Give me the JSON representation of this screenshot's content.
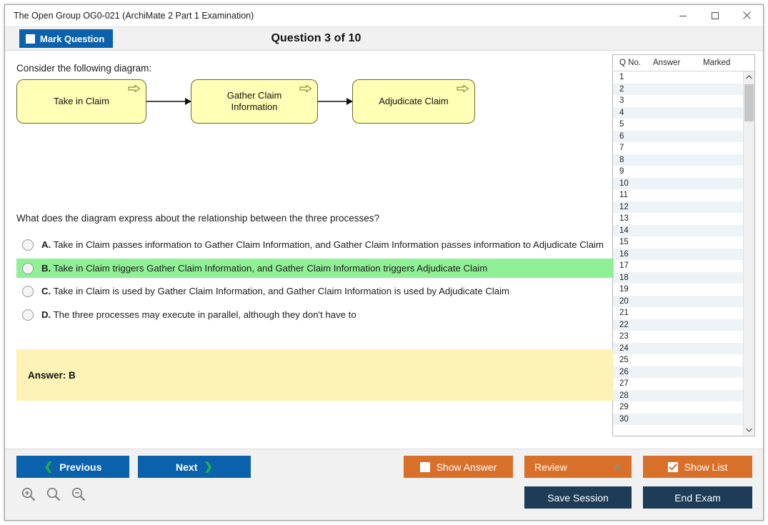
{
  "window": {
    "title": "The Open Group OG0-021 (ArchiMate 2 Part 1 Examination)",
    "minimize_label": "–",
    "maximize_label": "□",
    "close_label": "×"
  },
  "header": {
    "mark_question_label": "Mark Question",
    "question_counter": "Question 3 of 10"
  },
  "content": {
    "intro": "Consider the following diagram:",
    "question": "What does the diagram express about the relationship between the three processes?",
    "diagram": {
      "type": "archimate-business-process-flow",
      "nodes": [
        {
          "label": "Take in Claim"
        },
        {
          "label": "Gather Claim\nInformation"
        },
        {
          "label": "Adjudicate Claim"
        }
      ],
      "connector_type": "triggering"
    },
    "options": [
      {
        "letter": "A.",
        "text": "Take in Claim passes information to Gather Claim Information, and Gather Claim Information passes information to Adjudicate Claim",
        "selected": false,
        "correct": false
      },
      {
        "letter": "B.",
        "text": "Take in Claim triggers Gather Claim Information, and Gather Claim Information triggers Adjudicate Claim",
        "selected": false,
        "correct": true
      },
      {
        "letter": "C.",
        "text": "Take in Claim is used by Gather Claim Information, and Gather Claim Information is used by Adjudicate Claim",
        "selected": false,
        "correct": false
      },
      {
        "letter": "D.",
        "text": "The three processes may execute in parallel, although they don't have to",
        "selected": false,
        "correct": false
      }
    ],
    "answer_box": "Answer: B"
  },
  "list_panel": {
    "columns": [
      "Q No.",
      "Answer",
      "Marked"
    ],
    "rows": [
      {
        "q": "1",
        "answer": "",
        "marked": ""
      },
      {
        "q": "2",
        "answer": "",
        "marked": ""
      },
      {
        "q": "3",
        "answer": "",
        "marked": ""
      },
      {
        "q": "4",
        "answer": "",
        "marked": ""
      },
      {
        "q": "5",
        "answer": "",
        "marked": ""
      },
      {
        "q": "6",
        "answer": "",
        "marked": ""
      },
      {
        "q": "7",
        "answer": "",
        "marked": ""
      },
      {
        "q": "8",
        "answer": "",
        "marked": ""
      },
      {
        "q": "9",
        "answer": "",
        "marked": ""
      },
      {
        "q": "10",
        "answer": "",
        "marked": ""
      },
      {
        "q": "11",
        "answer": "",
        "marked": ""
      },
      {
        "q": "12",
        "answer": "",
        "marked": ""
      },
      {
        "q": "13",
        "answer": "",
        "marked": ""
      },
      {
        "q": "14",
        "answer": "",
        "marked": ""
      },
      {
        "q": "15",
        "answer": "",
        "marked": ""
      },
      {
        "q": "16",
        "answer": "",
        "marked": ""
      },
      {
        "q": "17",
        "answer": "",
        "marked": ""
      },
      {
        "q": "18",
        "answer": "",
        "marked": ""
      },
      {
        "q": "19",
        "answer": "",
        "marked": ""
      },
      {
        "q": "20",
        "answer": "",
        "marked": ""
      },
      {
        "q": "21",
        "answer": "",
        "marked": ""
      },
      {
        "q": "22",
        "answer": "",
        "marked": ""
      },
      {
        "q": "23",
        "answer": "",
        "marked": ""
      },
      {
        "q": "24",
        "answer": "",
        "marked": ""
      },
      {
        "q": "25",
        "answer": "",
        "marked": ""
      },
      {
        "q": "26",
        "answer": "",
        "marked": ""
      },
      {
        "q": "27",
        "answer": "",
        "marked": ""
      },
      {
        "q": "28",
        "answer": "",
        "marked": ""
      },
      {
        "q": "29",
        "answer": "",
        "marked": ""
      },
      {
        "q": "30",
        "answer": "",
        "marked": ""
      }
    ]
  },
  "footer": {
    "previous_label": "Previous",
    "next_label": "Next",
    "show_answer_label": "Show Answer",
    "show_answer_checked": false,
    "review_label": "Review",
    "show_list_label": "Show List",
    "show_list_checked": true,
    "save_session_label": "Save Session",
    "end_exam_label": "End Exam"
  },
  "colors": {
    "accent_blue": "#0a62ad",
    "accent_orange": "#d9702a",
    "accent_dark": "#1d3c57",
    "correct_green": "#90f096",
    "answer_yellow": "#fdf3b6",
    "diagram_fill": "#ffffb5",
    "chevron_green": "#22b14c"
  }
}
